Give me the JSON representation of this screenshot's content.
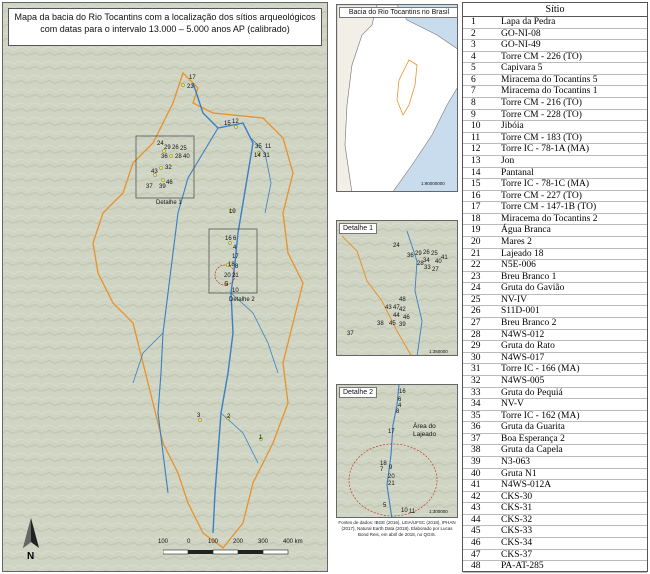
{
  "title": {
    "line1": "Mapa da bacia do Rio Tocantins com a localização dos sítios arqueológicos",
    "line2": "com datas para o intervalo 13.000 – 5.000 anos AP (calibrado)"
  },
  "inset_brazil": {
    "title": "Bacia do Rio Tocantins no Brasil",
    "scale": "1:90000000"
  },
  "detail1": {
    "title": "Detalhe 1",
    "scale": "1:350000",
    "main_label": "Detalhe 1"
  },
  "detail2": {
    "title": "Detalhe 2",
    "scale": "1:300000",
    "main_label": "Detalhe 2",
    "area_label_1": "Área do",
    "area_label_2": "Lajeado"
  },
  "scalebar": {
    "ticks": [
      "100",
      "0",
      "100",
      "200",
      "300",
      "400 km"
    ]
  },
  "north_label": "N",
  "credits": "Fontes de dados: IBGE (2016), LEIA/UFSC (2018), IPHAN (2017), Natural Earth Data (2018). Elaborado por Lucas Bond Reis, em abril de 2018, no QGIS.",
  "table_header": "Sítio",
  "sites": [
    {
      "num": "1",
      "name": "Lapa da Pedra"
    },
    {
      "num": "2",
      "name": "GO-NI-08"
    },
    {
      "num": "3",
      "name": "GO-NI-49"
    },
    {
      "num": "4",
      "name": "Torre CM - 226 (TO)"
    },
    {
      "num": "5",
      "name": "Capivara 5"
    },
    {
      "num": "6",
      "name": "Miracema do Tocantins 5"
    },
    {
      "num": "7",
      "name": "Miracema do Tocantins 1"
    },
    {
      "num": "8",
      "name": "Torre CM - 216 (TO)"
    },
    {
      "num": "9",
      "name": "Torre CM - 228 (TO)"
    },
    {
      "num": "10",
      "name": "Jibóia"
    },
    {
      "num": "11",
      "name": "Torre CM - 183 (TO)"
    },
    {
      "num": "12",
      "name": "Torre IC - 78-1A (MA)"
    },
    {
      "num": "13",
      "name": "Jon"
    },
    {
      "num": "14",
      "name": "Pantanal"
    },
    {
      "num": "15",
      "name": "Torre IC - 78-1C (MA)"
    },
    {
      "num": "16",
      "name": "Torre CM - 227 (TO)"
    },
    {
      "num": "17",
      "name": "Torre CM - 147-1B (TO)"
    },
    {
      "num": "18",
      "name": "Miracema do Tocantins 2"
    },
    {
      "num": "19",
      "name": "Água Branca"
    },
    {
      "num": "20",
      "name": "Mares 2"
    },
    {
      "num": "21",
      "name": "Lajeado 18"
    },
    {
      "num": "22",
      "name": "N5E-006"
    },
    {
      "num": "23",
      "name": "Breu Branco 1"
    },
    {
      "num": "24",
      "name": "Gruta do Gavião"
    },
    {
      "num": "25",
      "name": "NV-IV"
    },
    {
      "num": "26",
      "name": "S11D-001"
    },
    {
      "num": "27",
      "name": "Breu Branco 2"
    },
    {
      "num": "28",
      "name": "N4WS-012"
    },
    {
      "num": "29",
      "name": "Gruta do Rato"
    },
    {
      "num": "30",
      "name": "N4WS-017"
    },
    {
      "num": "31",
      "name": "Torre IC - 166 (MA)"
    },
    {
      "num": "32",
      "name": "N4WS-005"
    },
    {
      "num": "33",
      "name": "Gruta do Pequiá"
    },
    {
      "num": "34",
      "name": "NV-V"
    },
    {
      "num": "35",
      "name": "Torre IC - 162 (MA)"
    },
    {
      "num": "36",
      "name": "Gruta da Guarita"
    },
    {
      "num": "37",
      "name": "Boa Esperança 2"
    },
    {
      "num": "38",
      "name": "Gruta da Capela"
    },
    {
      "num": "39",
      "name": "N3-063"
    },
    {
      "num": "40",
      "name": "Gruta N1"
    },
    {
      "num": "41",
      "name": "N4WS-012A"
    },
    {
      "num": "42",
      "name": "CKS-30"
    },
    {
      "num": "43",
      "name": "CKS-31"
    },
    {
      "num": "44",
      "name": "CKS-32"
    },
    {
      "num": "45",
      "name": "CKS-33"
    },
    {
      "num": "46",
      "name": "CKS-34"
    },
    {
      "num": "47",
      "name": "CKS-37"
    },
    {
      "num": "48",
      "name": "PA-AT-285"
    }
  ],
  "map_labels": {
    "main": [
      {
        "text": "17"
      },
      {
        "text": "23"
      },
      {
        "text": "15"
      },
      {
        "text": "12"
      },
      {
        "text": "35"
      },
      {
        "text": "11"
      },
      {
        "text": "14"
      },
      {
        "text": "31"
      },
      {
        "text": "24"
      },
      {
        "text": "29"
      },
      {
        "text": "26"
      },
      {
        "text": "25"
      },
      {
        "text": "36"
      },
      {
        "text": "28"
      },
      {
        "text": "40"
      },
      {
        "text": "43"
      },
      {
        "text": "32"
      },
      {
        "text": "46"
      },
      {
        "text": "39"
      },
      {
        "text": "37"
      },
      {
        "text": "19"
      },
      {
        "text": "16"
      },
      {
        "text": "6"
      },
      {
        "text": "4"
      },
      {
        "text": "17"
      },
      {
        "text": "18"
      },
      {
        "text": "8"
      },
      {
        "text": "20"
      },
      {
        "text": "21"
      },
      {
        "text": "5"
      },
      {
        "text": "10"
      },
      {
        "text": "3"
      },
      {
        "text": "2"
      },
      {
        "text": "1"
      }
    ],
    "detail1": [
      {
        "text": "24"
      },
      {
        "text": "36"
      },
      {
        "text": "29"
      },
      {
        "text": "26"
      },
      {
        "text": "25"
      },
      {
        "text": "34"
      },
      {
        "text": "28"
      },
      {
        "text": "33"
      },
      {
        "text": "40"
      },
      {
        "text": "41"
      },
      {
        "text": "27"
      },
      {
        "text": "48"
      },
      {
        "text": "43"
      },
      {
        "text": "47"
      },
      {
        "text": "42"
      },
      {
        "text": "44"
      },
      {
        "text": "46"
      },
      {
        "text": "38"
      },
      {
        "text": "45"
      },
      {
        "text": "39"
      },
      {
        "text": "37"
      }
    ],
    "detail2": [
      {
        "text": "16"
      },
      {
        "text": "6"
      },
      {
        "text": "4"
      },
      {
        "text": "8"
      },
      {
        "text": "17"
      },
      {
        "text": "18"
      },
      {
        "text": "7"
      },
      {
        "text": "9"
      },
      {
        "text": "20"
      },
      {
        "text": "21"
      },
      {
        "text": "5"
      },
      {
        "text": "10"
      },
      {
        "text": "11"
      }
    ]
  },
  "colors": {
    "terrain": "#cfd4c3",
    "river": "#3a7fc4",
    "basin_boundary": "#e8922a",
    "site_dot": "#e8e84a",
    "ocean": "#c9dced",
    "land": "#f2efe6",
    "brazil": "#ffffff"
  }
}
